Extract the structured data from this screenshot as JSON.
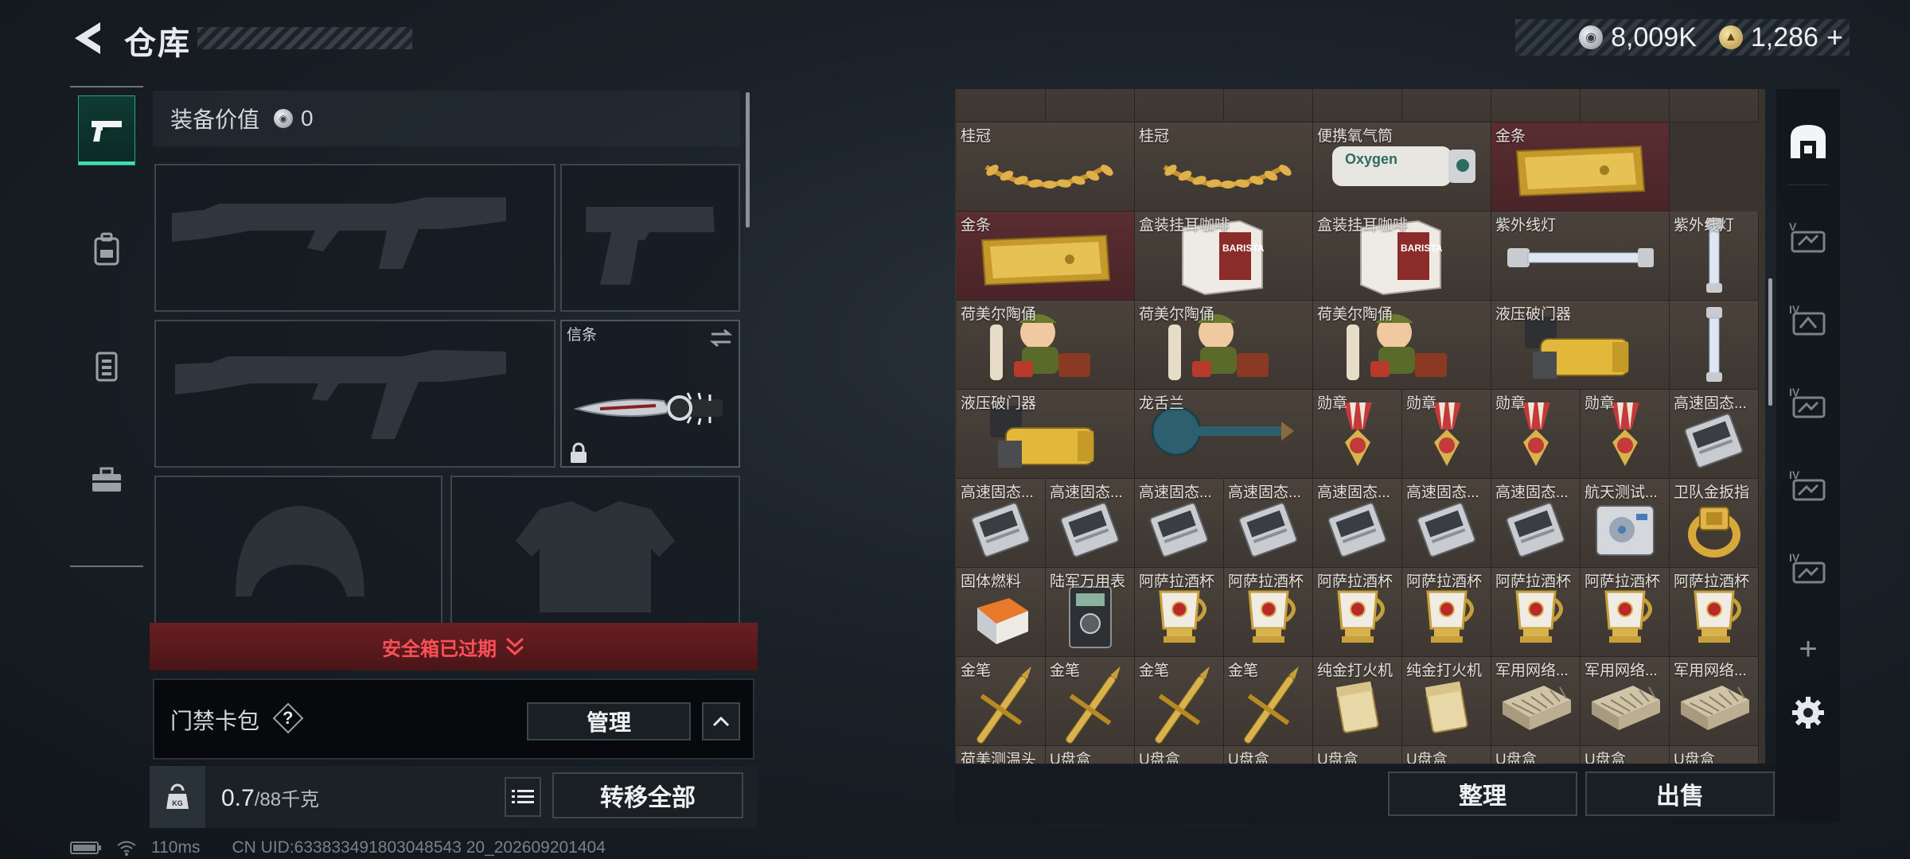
{
  "header": {
    "title": "仓库",
    "currencies": [
      {
        "icon": "silver-coin-icon",
        "value": "8,009K"
      },
      {
        "icon": "gold-coin-icon",
        "value": "1,286",
        "suffix": "+"
      }
    ]
  },
  "left_rail": {
    "items": [
      {
        "icon": "pistol-icon",
        "active": true
      },
      {
        "icon": "backpack-icon",
        "active": false
      },
      {
        "icon": "vest-icon",
        "active": false
      },
      {
        "icon": "toolbox-icon",
        "active": false
      }
    ]
  },
  "equipment": {
    "value_label": "装备价值",
    "value": "0",
    "knife_slot_label": "信条",
    "safebox_status": "安全箱已过期",
    "keycard_label": "门禁卡包",
    "help_symbol": "?",
    "manage_label": "管理",
    "weight_current": "0.7",
    "weight_max": "/88千克",
    "transfer_all_label": "转移全部"
  },
  "status_bar": {
    "ping": "110ms",
    "uid": "CN UID:633833491803048543 20_202609201404"
  },
  "inventory": {
    "rows": [
      [
        {
          "label": "桂冠",
          "icon": "laurel-crown-icon",
          "wide": true
        },
        {
          "label": "桂冠",
          "icon": "laurel-crown-icon",
          "wide": true
        },
        {
          "label": "便携氧气筒",
          "icon": "oxygen-tank-icon",
          "wide": true
        },
        {
          "label": "金条",
          "icon": "gold-bar-icon",
          "wide": true,
          "red": true
        }
      ],
      [
        {
          "label": "金条",
          "icon": "gold-bar-icon",
          "wide": true,
          "red": true
        },
        {
          "label": "盒装挂耳咖啡",
          "icon": "coffee-box-icon",
          "wide": true
        },
        {
          "label": "盒装挂耳咖啡",
          "icon": "coffee-box-icon",
          "wide": true
        },
        {
          "label": "紫外线灯",
          "icon": "uv-lamp-icon",
          "wide": true
        },
        {
          "label": "紫外线灯",
          "icon": "uv-lamp-vertical-icon",
          "wide": false
        }
      ],
      [
        {
          "label": "荷美尔陶俑",
          "icon": "figurine-icon",
          "wide": true
        },
        {
          "label": "荷美尔陶俑",
          "icon": "figurine-icon",
          "wide": true
        },
        {
          "label": "荷美尔陶俑",
          "icon": "figurine-icon",
          "wide": true
        },
        {
          "label": "液压破门器",
          "icon": "hydraulic-breacher-icon",
          "wide": true
        },
        {
          "label": "",
          "icon": "uv-lamp-vertical-icon",
          "wide": false
        }
      ],
      [
        {
          "label": "液压破门器",
          "icon": "hydraulic-breacher-icon",
          "wide": true
        },
        {
          "label": "龙舌兰",
          "icon": "tequila-bottle-icon",
          "wide": true
        },
        {
          "label": "勋章",
          "icon": "medal-icon",
          "wide": false
        },
        {
          "label": "勋章",
          "icon": "medal-icon",
          "wide": false
        },
        {
          "label": "勋章",
          "icon": "medal-icon",
          "wide": false
        },
        {
          "label": "勋章",
          "icon": "medal-icon",
          "wide": false
        },
        {
          "label": "高速固态...",
          "icon": "ssd-icon",
          "wide": false
        }
      ],
      [
        {
          "label": "高速固态...",
          "icon": "ssd-icon",
          "wide": false
        },
        {
          "label": "高速固态...",
          "icon": "ssd-icon",
          "wide": false
        },
        {
          "label": "高速固态...",
          "icon": "ssd-icon",
          "wide": false
        },
        {
          "label": "高速固态...",
          "icon": "ssd-icon",
          "wide": false
        },
        {
          "label": "高速固态...",
          "icon": "ssd-icon",
          "wide": false
        },
        {
          "label": "高速固态...",
          "icon": "ssd-icon",
          "wide": false
        },
        {
          "label": "高速固态...",
          "icon": "ssd-icon",
          "wide": false
        },
        {
          "label": "航天测试...",
          "icon": "hard-drive-icon",
          "wide": false
        },
        {
          "label": "卫队金扳指",
          "icon": "gold-ring-icon",
          "wide": false
        }
      ],
      [
        {
          "label": "固体燃料",
          "icon": "solid-fuel-icon",
          "wide": false
        },
        {
          "label": "陆军万用表",
          "icon": "multimeter-icon",
          "wide": false
        },
        {
          "label": "阿萨拉酒杯",
          "icon": "golden-goblet-icon",
          "wide": false
        },
        {
          "label": "阿萨拉酒杯",
          "icon": "golden-goblet-icon",
          "wide": false
        },
        {
          "label": "阿萨拉酒杯",
          "icon": "golden-goblet-icon",
          "wide": false
        },
        {
          "label": "阿萨拉酒杯",
          "icon": "golden-goblet-icon",
          "wide": false
        },
        {
          "label": "阿萨拉酒杯",
          "icon": "golden-goblet-icon",
          "wide": false
        },
        {
          "label": "阿萨拉酒杯",
          "icon": "golden-goblet-icon",
          "wide": false
        },
        {
          "label": "阿萨拉酒杯",
          "icon": "golden-goblet-icon",
          "wide": false
        }
      ],
      [
        {
          "label": "金笔",
          "icon": "gold-pen-icon",
          "wide": false
        },
        {
          "label": "金笔",
          "icon": "gold-pen-icon",
          "wide": false
        },
        {
          "label": "金笔",
          "icon": "gold-pen-icon",
          "wide": false
        },
        {
          "label": "金笔",
          "icon": "gold-pen-icon",
          "wide": false
        },
        {
          "label": "纯金打火机",
          "icon": "gold-lighter-icon",
          "wide": false
        },
        {
          "label": "纯金打火机",
          "icon": "gold-lighter-icon",
          "wide": false
        },
        {
          "label": "军用网络...",
          "icon": "network-module-icon",
          "wide": false
        },
        {
          "label": "军用网络...",
          "icon": "network-module-icon",
          "wide": false
        },
        {
          "label": "军用网络...",
          "icon": "network-module-icon",
          "wide": false
        }
      ],
      [
        {
          "label": "荷美测温头",
          "icon": "generic-item-icon",
          "wide": false
        },
        {
          "label": "U盘盒",
          "icon": "generic-item-icon",
          "wide": false
        },
        {
          "label": "U盘盒",
          "icon": "generic-item-icon",
          "wide": false
        },
        {
          "label": "U盘盒",
          "icon": "generic-item-icon",
          "wide": false
        },
        {
          "label": "U盘盒",
          "icon": "generic-item-icon",
          "wide": false
        },
        {
          "label": "U盘盒",
          "icon": "generic-item-icon",
          "wide": false
        },
        {
          "label": "U盘盒",
          "icon": "generic-item-icon",
          "wide": false
        },
        {
          "label": "U盘盒",
          "icon": "generic-item-icon",
          "wide": false
        },
        {
          "label": "U盘盒",
          "icon": "generic-item-icon",
          "wide": false
        }
      ]
    ]
  },
  "inventory_actions": {
    "sort_label": "整理",
    "sell_label": "出售"
  },
  "right_rail": {
    "items": [
      {
        "icon": "warehouse-icon"
      },
      {
        "icon": "storage-tier-v-icon"
      },
      {
        "icon": "storage-tier-iv-icon"
      },
      {
        "icon": "storage-tier-iv-icon"
      },
      {
        "icon": "storage-tier-iv-icon"
      },
      {
        "icon": "storage-tier-iv-icon"
      },
      {
        "icon": "add-storage-icon",
        "symbol": "+"
      },
      {
        "icon": "gear-icon"
      }
    ]
  },
  "colors": {
    "accent_green": "#3ce0b2",
    "warning_red": "#ff5057",
    "gold": "#d6a93a"
  }
}
